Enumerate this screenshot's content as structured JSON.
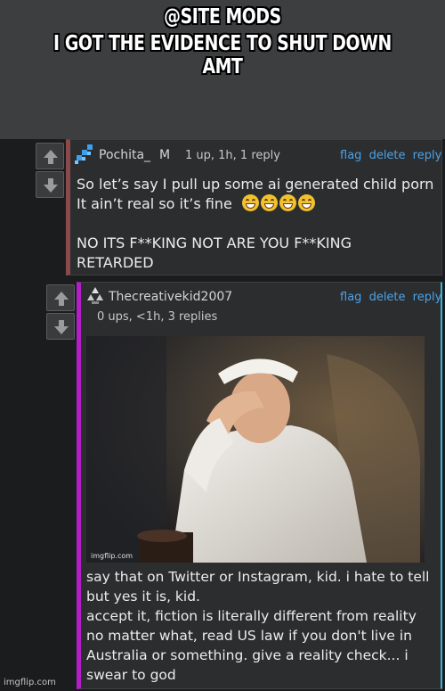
{
  "caption": {
    "line1": "@SITE MODS",
    "line2": "I GOT THE EVIDENCE TO SHUT DOWN AMT"
  },
  "comments": [
    {
      "username": "Pochita_",
      "badge": "M",
      "meta": "1 up, 1h, 1 reply",
      "actions": {
        "flag": "flag",
        "delete": "delete",
        "reply": "reply"
      },
      "lines": [
        "So let’s say I pull up some ai generated child porn",
        "It ain’t real so it’s fine",
        "",
        "NO ITS F**KING NOT ARE YOU F**KING",
        "RETARDED"
      ],
      "emoji": [
        "grinning-face",
        "grinning-face",
        "grinning-face",
        "grinning-face"
      ],
      "border_color": "#8a4a4a"
    },
    {
      "username": "Thecreativekid2007",
      "meta": "0 ups, <1h, 3 replies",
      "actions": {
        "flag": "flag",
        "delete": "delete",
        "reply": "reply"
      },
      "image_watermark": "imgflip.com",
      "lines": [
        "say that on Twitter or Instagram, kid. i hate to tell",
        "but yes it is, kid.",
        "accept it, fiction is literally different from reality",
        "no matter what, read US law if you don't live in",
        "Australia or something. give a reality check... i",
        "swear to god"
      ],
      "border_color": "#b41ec8"
    }
  ],
  "watermark": "imgflip.com",
  "icons": {
    "upvote": "arrow-up-icon",
    "downvote": "arrow-down-icon",
    "avatar1": "pixel-pattern-icon",
    "avatar2": "triangle-cluster-icon"
  },
  "colors": {
    "link": "#4aa3e8",
    "background": "#2c2d2f"
  }
}
